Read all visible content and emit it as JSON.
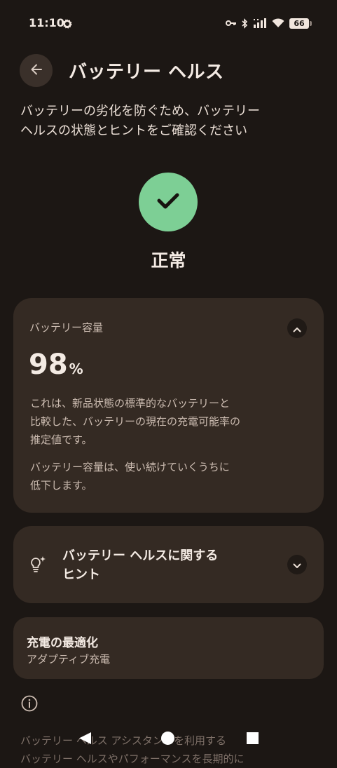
{
  "status_bar": {
    "time": "11:10",
    "battery_level": "66",
    "icons": [
      "app-notification-icon",
      "vpn-key-icon",
      "bluetooth-icon",
      "cell-signal-icon",
      "wifi-icon",
      "battery-icon"
    ]
  },
  "header": {
    "back_icon": "arrow-left-icon",
    "title": "バッテリー ヘルス"
  },
  "description_lines": [
    "バッテリーの劣化を防ぐため、バッテリー",
    "ヘルスの状態とヒントをご確認ください"
  ],
  "health": {
    "status": "正常",
    "icon": "check-icon",
    "accent_color": "#7dcf95"
  },
  "capacity_card": {
    "label": "バッテリー容量",
    "value": "98",
    "unit": "%",
    "description_lines": [
      "これは、新品状態の標準的なバッテリーと",
      "比較した、バッテリーの現在の充電可能率の",
      "推定値です。"
    ],
    "note_lines": [
      "バッテリー容量は、使い続けていくうちに",
      "低下します。"
    ],
    "toggle_icon": "chevron-up-icon"
  },
  "tips_card": {
    "title_lines": [
      "バッテリー ヘルスに関する",
      "ヒント"
    ],
    "icon": "lightbulb-sparkle-icon",
    "toggle_icon": "chevron-down-icon"
  },
  "charging_card": {
    "title": "充電の最適化",
    "subtitle": "アダプティブ充電"
  },
  "footer": {
    "icon": "info-icon",
    "lines": [
      "バッテリー ヘルス アシスタントを利用する",
      "バッテリー ヘルスやパフォーマンスを長期的に"
    ]
  },
  "nav_bar": {
    "back": "nav-back-icon",
    "home": "nav-home-icon",
    "recents": "nav-recents-icon"
  }
}
